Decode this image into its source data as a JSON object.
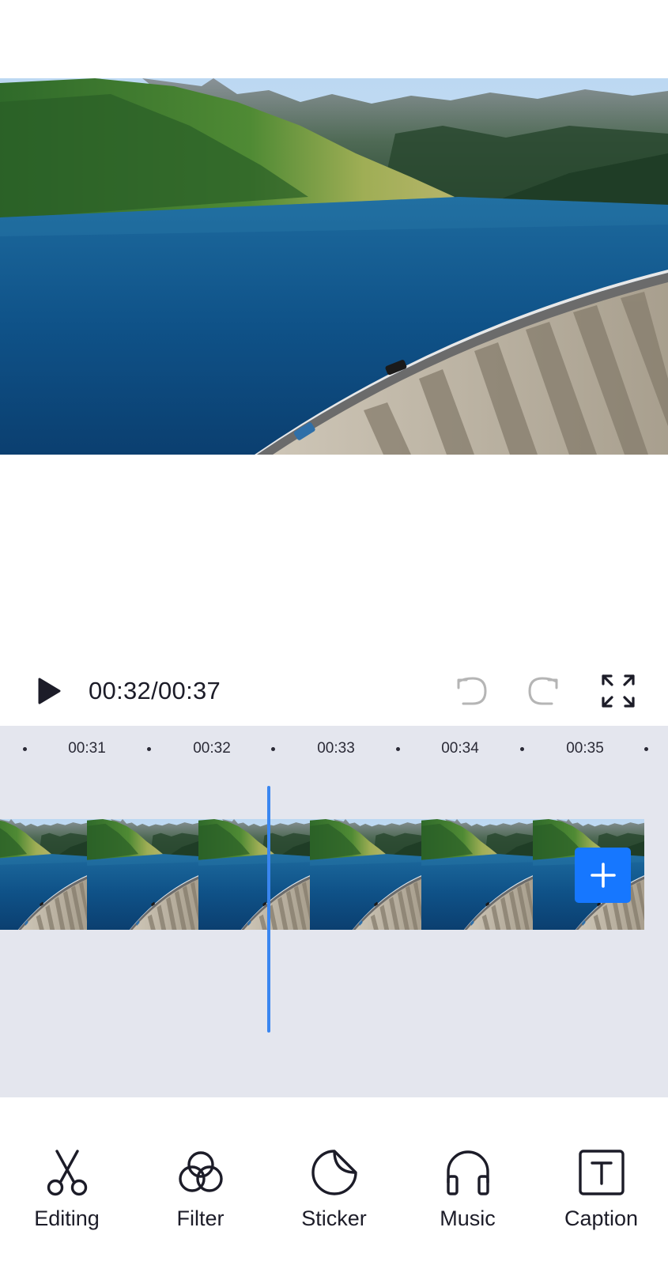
{
  "player": {
    "current_time": "00:32",
    "total_time": "00:37",
    "time_display": "00:32/00:37"
  },
  "icons": {
    "play": "play-icon",
    "undo": "undo-icon",
    "redo": "redo-icon",
    "fullscreen": "fullscreen-icon",
    "add_clip": "plus-icon"
  },
  "timeline": {
    "ruler_labels": [
      "00:31",
      "00:32",
      "00:33",
      "00:34",
      "00:35"
    ],
    "playhead_time": "00:32",
    "thumbnail_count": 6
  },
  "toolbar": {
    "items": [
      {
        "label": "Editing",
        "icon": "scissors-icon"
      },
      {
        "label": "Filter",
        "icon": "filter-circles-icon"
      },
      {
        "label": "Sticker",
        "icon": "sticker-icon"
      },
      {
        "label": "Music",
        "icon": "headphones-icon"
      },
      {
        "label": "Caption",
        "icon": "caption-text-icon"
      }
    ]
  },
  "colors": {
    "accent": "#1677ff",
    "playhead": "#3a86f0",
    "timeline_bg": "#e4e6ee",
    "text": "#1c1c28",
    "disabled_icon": "#b5b5b5"
  }
}
